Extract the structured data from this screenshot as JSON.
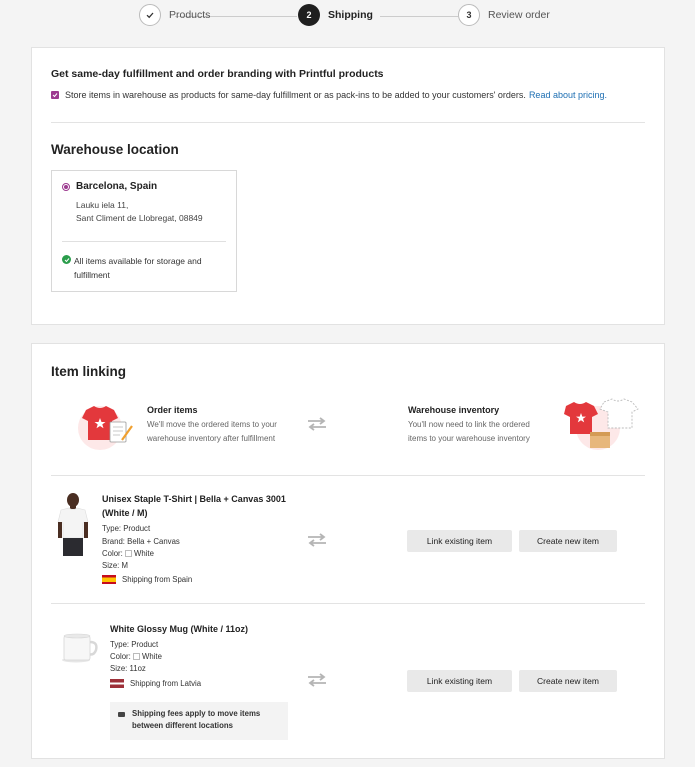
{
  "stepper": {
    "steps": [
      {
        "number": "1",
        "label": "Products",
        "state": "done"
      },
      {
        "number": "2",
        "label": "Shipping",
        "state": "active"
      },
      {
        "number": "3",
        "label": "Review order",
        "state": "todo"
      }
    ]
  },
  "fulfillment": {
    "title": "Get same-day fulfillment and order branding with Printful products",
    "checkbox_label": "Store items in warehouse as products for same-day fulfillment or as pack-ins to be added to your customers' orders.",
    "checkbox_checked": true,
    "link_text": "Read about pricing."
  },
  "warehouse": {
    "section_title": "Warehouse location",
    "name": "Barcelona, Spain",
    "address_line1": "Lauku iela 11,",
    "address_line2": "Sant Climent de Llobregat, 08849",
    "availability": "All items available for storage and fulfillment"
  },
  "item_linking": {
    "section_title": "Item linking",
    "order_items": {
      "title": "Order items",
      "description": "We'll move the ordered items to your warehouse inventory after fulfillment"
    },
    "warehouse_inventory": {
      "title": "Warehouse inventory",
      "description": "You'll now need to link the ordered items to your warehouse inventory"
    },
    "items": [
      {
        "name": "Unisex Staple T-Shirt | Bella + Canvas 3001 (White / M)",
        "type": "Type: Product",
        "brand": "Brand: Bella + Canvas",
        "color_label": "Color:",
        "color": "White",
        "size": "Size: M",
        "shipping": "Shipping from Spain",
        "link_button": "Link existing item",
        "create_button": "Create new item"
      },
      {
        "name": "White Glossy Mug (White / 11oz)",
        "type": "Type: Product",
        "color_label": "Color:",
        "color": "White",
        "size": "Size: 11oz",
        "shipping": "Shipping from Latvia",
        "link_button": "Link existing item",
        "create_button": "Create new item"
      }
    ],
    "notice": "Shipping fees apply to move items between different locations"
  },
  "colors": {
    "accent": "#9c3a8f",
    "link": "#1e6fb3",
    "success": "#2a9d4b",
    "step_active": "#1f1f1f"
  }
}
